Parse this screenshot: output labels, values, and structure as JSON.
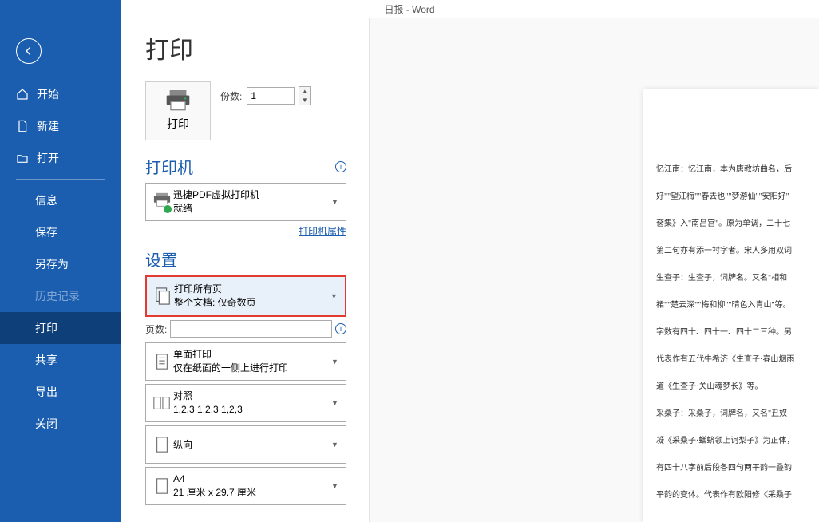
{
  "titlebar": "日报  -  Word",
  "sidebar": {
    "start": "开始",
    "new": "新建",
    "open": "打开",
    "info": "信息",
    "save": "保存",
    "saveas": "另存为",
    "history": "历史记录",
    "print": "打印",
    "share": "共享",
    "export": "导出",
    "close": "关闭"
  },
  "main": {
    "title": "打印",
    "printBtn": "打印",
    "copiesLabel": "份数:",
    "copiesValue": "1",
    "printerHeader": "打印机",
    "printerName": "迅捷PDF虚拟打印机",
    "printerStatus": "就绪",
    "printerProps": "打印机属性",
    "settingsHeader": "设置",
    "printPages": {
      "title": "打印所有页",
      "sub": "整个文档: 仅奇数页"
    },
    "pagesLabel": "页数:",
    "pagesValue": "",
    "duplex": {
      "title": "单面打印",
      "sub": "仅在纸面的一侧上进行打印"
    },
    "collate": {
      "title": "对照",
      "sub": "1,2,3     1,2,3     1,2,3"
    },
    "orientation": {
      "title": "纵向"
    },
    "paper": {
      "title": "A4",
      "sub": "21 厘米 x 29.7 厘米"
    }
  },
  "preview": {
    "p1": "忆江南：忆江南，本为唐教坊曲名，后",
    "p2": "好\"\"望江梅\"\"春去也\"\"梦游仙\"\"安阳好\"",
    "p3": "奁集》入\"南吕宫\"。原为单调，二十七",
    "p4": "第二句亦有添一衬字者。宋人多用双词",
    "p5": "生查子：生查子，词牌名。又名\"相和",
    "p6": "裙\"\"楚云深\"\"梅和柳\"\"晴色入青山\"等。",
    "p7": "字数有四十、四十一、四十二三种。另",
    "p8": "代表作有五代牛希济《生查子·春山烟雨",
    "p9": "道《生查子·关山魂梦长》等。",
    "p10": "采桑子：采桑子，词牌名，又名\"丑奴",
    "p11": "凝《采桑子·蝤蛴领上诃梨子》为正体，",
    "p12": "有四十八字前后段各四句两平韵一叠韵",
    "p13": "平韵的变体。代表作有欧阳修《采桑子"
  }
}
